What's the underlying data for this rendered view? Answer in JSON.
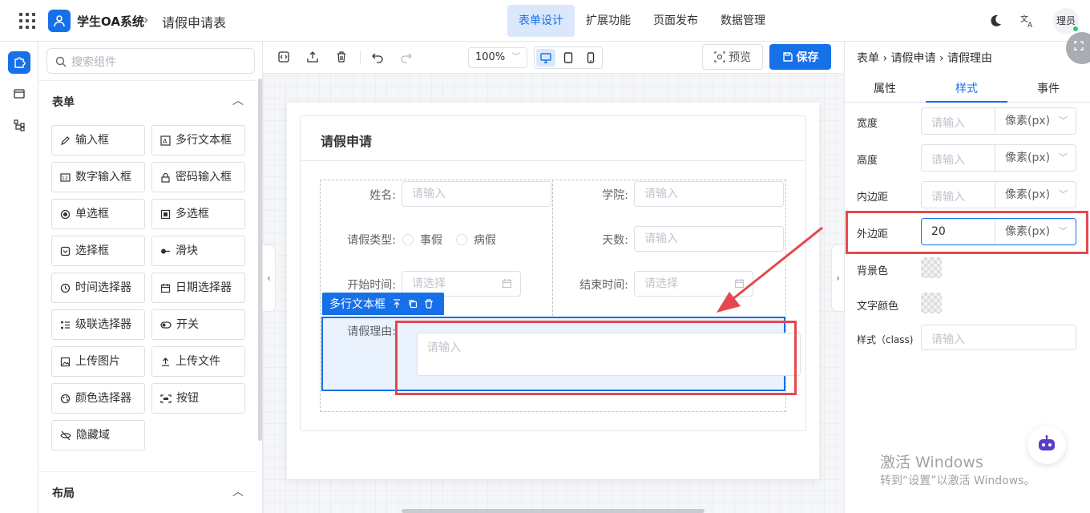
{
  "header": {
    "brand": "学生OA系统",
    "crumb_sep": "›",
    "page_title": "请假申请表",
    "nav": [
      "表单设计",
      "扩展功能",
      "页面发布",
      "数据管理"
    ],
    "avatar_text": "理员"
  },
  "components": {
    "search_placeholder": "搜索组件",
    "section_form": "表单",
    "section_layout": "布局",
    "items": [
      "输入框",
      "多行文本框",
      "数字输入框",
      "密码输入框",
      "单选框",
      "多选框",
      "选择框",
      "滑块",
      "时间选择器",
      "日期选择器",
      "级联选择器",
      "开关",
      "上传图片",
      "上传文件",
      "颜色选择器",
      "按钮",
      "隐藏域"
    ]
  },
  "toolbar": {
    "zoom": "100%",
    "preview_label": "预览",
    "save_label": "保存"
  },
  "form": {
    "title": "请假申请",
    "name_label": "姓名:",
    "name_placeholder": "请输入",
    "college_label": "学院:",
    "college_placeholder": "请输入",
    "type_label": "请假类型:",
    "type_options": [
      "事假",
      "病假"
    ],
    "days_label": "天数:",
    "days_placeholder": "请输入",
    "start_label": "开始时间:",
    "start_placeholder": "请选择",
    "end_label": "结束时间:",
    "end_placeholder": "请选择",
    "selected_tag": "多行文本框",
    "reason_label": "请假理由:",
    "reason_placeholder": "请输入"
  },
  "properties": {
    "breadcrumb": "表单 › 请假申请 › 请假理由",
    "tabs": [
      "属性",
      "样式",
      "事件"
    ],
    "active_tab": "样式",
    "width_label": "宽度",
    "height_label": "高度",
    "padding_label": "内边距",
    "margin_label": "外边距",
    "margin_value": "20",
    "bg_label": "背景色",
    "color_label": "文字颜色",
    "class_label": "样式（class)",
    "placeholder": "请输入",
    "unit": "像素(px)"
  },
  "watermark": {
    "line1": "激活 Windows",
    "line2": "转到“设置”以激活 Windows。"
  },
  "colors": {
    "accent": "#1670e8",
    "highlight_red": "#e5484d"
  }
}
